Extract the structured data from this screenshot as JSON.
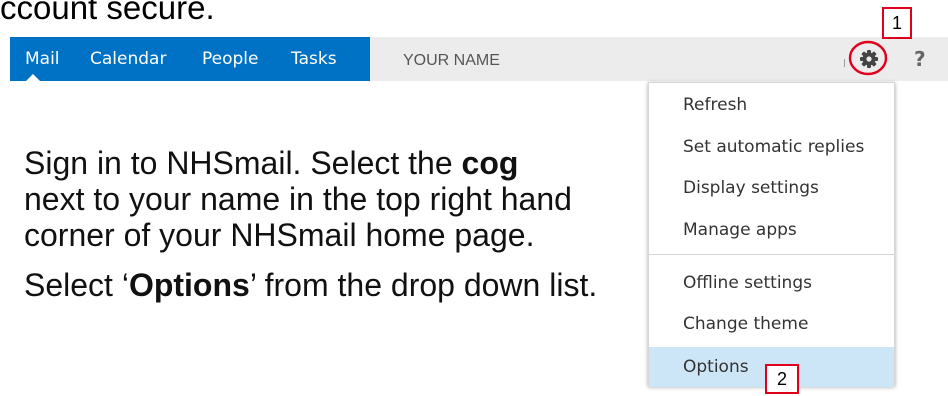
{
  "heading_fragment": "ccount secure.",
  "nav": {
    "items": [
      "Mail",
      "Calendar",
      "People",
      "Tasks"
    ]
  },
  "user": {
    "name": "YOUR NAME"
  },
  "icons": {
    "settings": "gear-icon",
    "help": "help-icon",
    "help_glyph": "?"
  },
  "colors": {
    "nav_background": "#0072c6",
    "name_bar_background": "#ececec",
    "callout_red": "#e0001b",
    "selected_item": "#cde6f7"
  },
  "callouts": {
    "one": "1",
    "two": "2"
  },
  "instructions": {
    "p1_before": "Sign in to NHSmail. Select the ",
    "p1_bold": "cog",
    "p1_after": " next to your name in the top right hand corner of your NHSmail home page.",
    "p2_before": "Select ‘",
    "p2_bold": "Options",
    "p2_after": "’ from the drop down list."
  },
  "menu": {
    "items": [
      "Refresh",
      "Set automatic replies",
      "Display settings",
      "Manage apps",
      "Offline settings",
      "Change theme",
      "Options"
    ],
    "selected": "Options"
  }
}
